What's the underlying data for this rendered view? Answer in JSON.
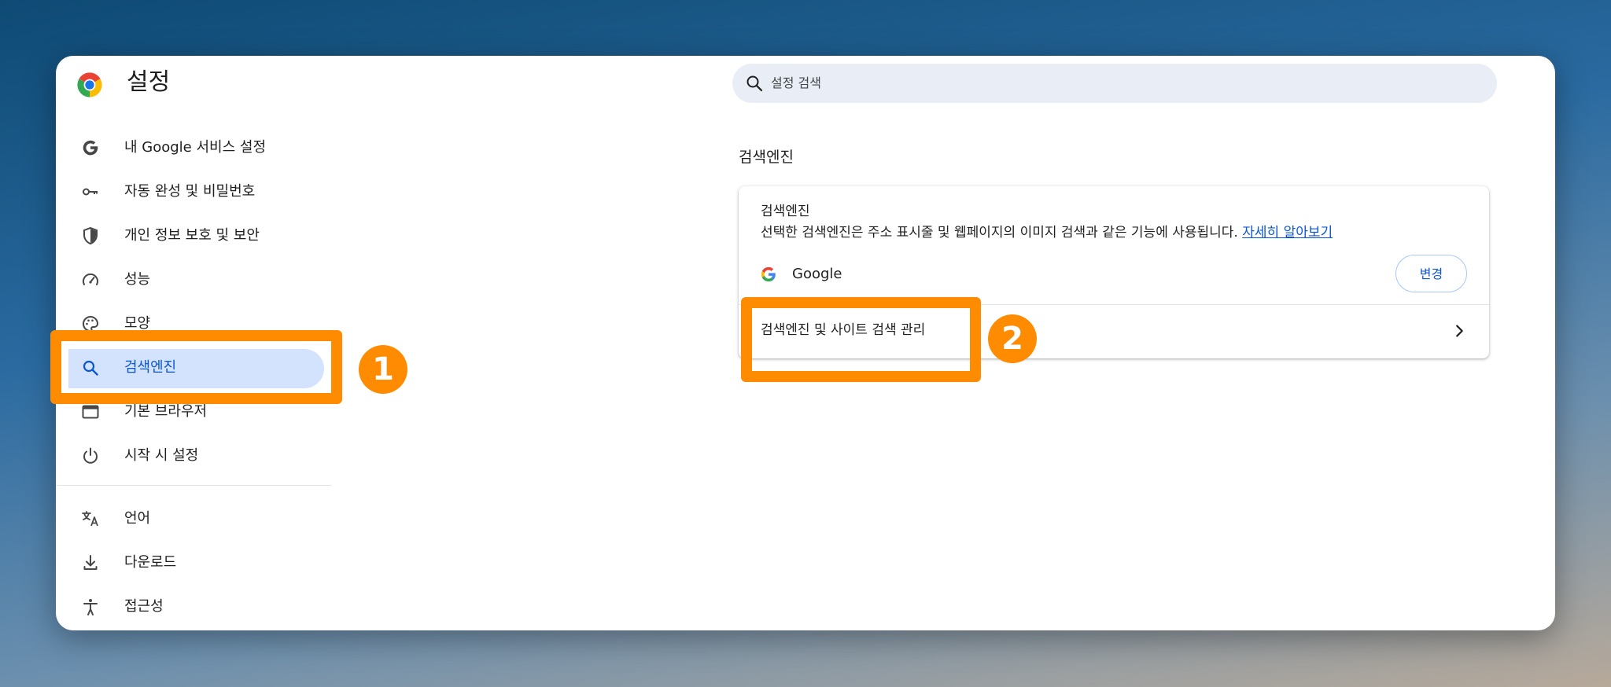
{
  "window": {
    "title": "설정",
    "search": {
      "placeholder": "설정 검색"
    }
  },
  "sidebar": {
    "items": [
      {
        "label": "내 Google 서비스 설정",
        "icon": "google-g-icon"
      },
      {
        "label": "자동 완성 및 비밀번호",
        "icon": "key-icon"
      },
      {
        "label": "개인 정보 보호 및 보안",
        "icon": "shield-icon"
      },
      {
        "label": "성능",
        "icon": "speedometer-icon"
      },
      {
        "label": "모양",
        "icon": "palette-icon"
      },
      {
        "label": "검색엔진",
        "icon": "search-icon",
        "active": true
      },
      {
        "label": "기본 브라우저",
        "icon": "browser-window-icon"
      },
      {
        "label": "시작 시 설정",
        "icon": "power-icon"
      },
      {
        "label": "언어",
        "icon": "translate-icon"
      },
      {
        "label": "다운로드",
        "icon": "download-icon"
      },
      {
        "label": "접근성",
        "icon": "accessibility-icon"
      }
    ]
  },
  "main": {
    "section_title": "검색엔진",
    "card": {
      "title": "검색엔진",
      "description": "선택한 검색엔진은 주소 표시줄 및 웹페이지의 이미지 검색과 같은 기능에 사용됩니다.",
      "learn_more": "자세히 알아보기",
      "engine_name": "Google",
      "change_button": "변경",
      "manage_label": "검색엔진 및 사이트 검색 관리"
    }
  },
  "annotations": {
    "badge1": "1",
    "badge2": "2",
    "color": "#ff8c00"
  },
  "colors": {
    "accent": "#0b57d0",
    "active_bg": "#d3e3fd",
    "search_bg": "#e9edf6"
  }
}
